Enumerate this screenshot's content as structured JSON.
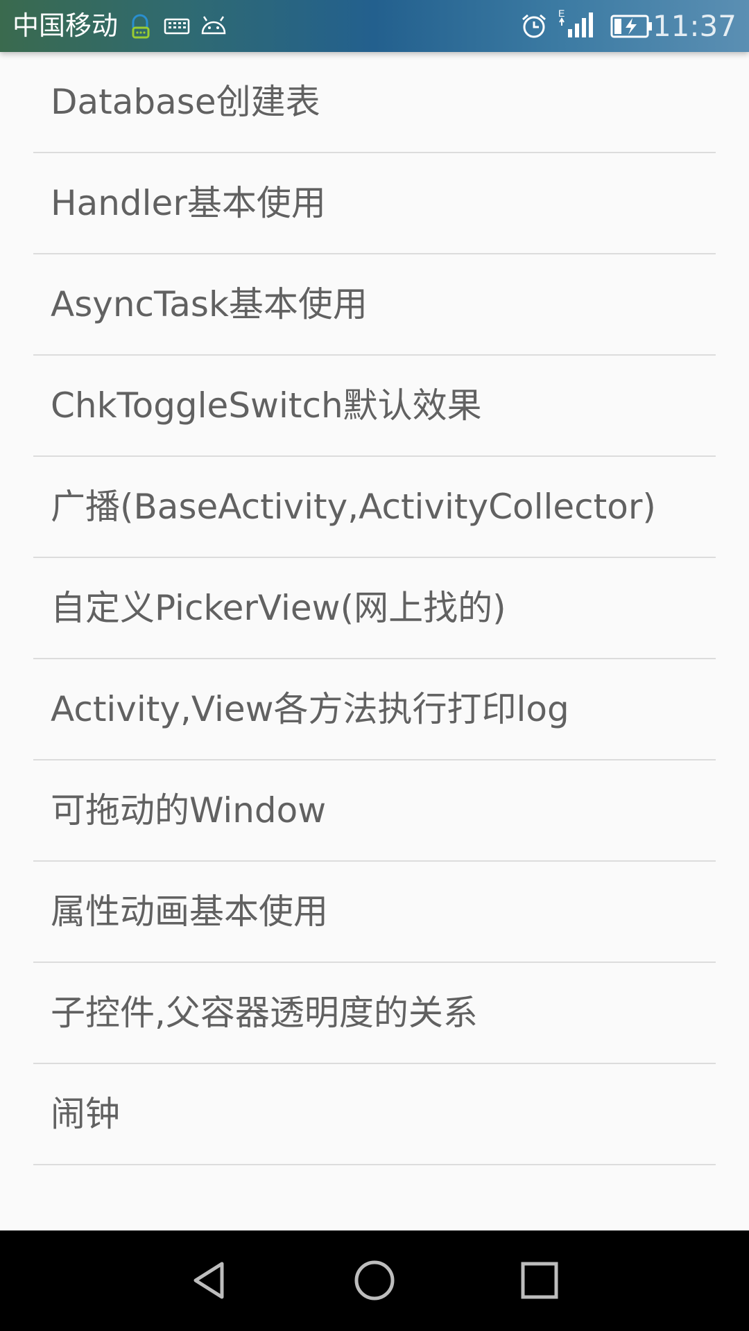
{
  "status_bar": {
    "carrier": "中国移动",
    "time": "11:37",
    "icons": [
      "chat-notification-icon",
      "keyboard-icon",
      "android-debug-icon",
      "alarm-icon",
      "signal-icon",
      "battery-charging-icon"
    ],
    "network_letter": "E"
  },
  "list": {
    "items": [
      {
        "label": "Database创建表"
      },
      {
        "label": "Handler基本使用"
      },
      {
        "label": "AsyncTask基本使用"
      },
      {
        "label": "ChkToggleSwitch默认效果"
      },
      {
        "label": "广播(BaseActivity,ActivityCollector)"
      },
      {
        "label": "自定义PickerView(网上找的)"
      },
      {
        "label": "Activity,View各方法执行打印log"
      },
      {
        "label": "可拖动的Window"
      },
      {
        "label": "属性动画基本使用"
      },
      {
        "label": "子控件,父容器透明度的关系"
      },
      {
        "label": "闹钟"
      }
    ]
  },
  "nav_bar": {
    "buttons": [
      "back-icon",
      "home-icon",
      "recents-icon"
    ]
  },
  "colors": {
    "background": "#fafafa",
    "text": "#616161",
    "divider": "#dcdcdc",
    "nav_bar": "#000000"
  }
}
